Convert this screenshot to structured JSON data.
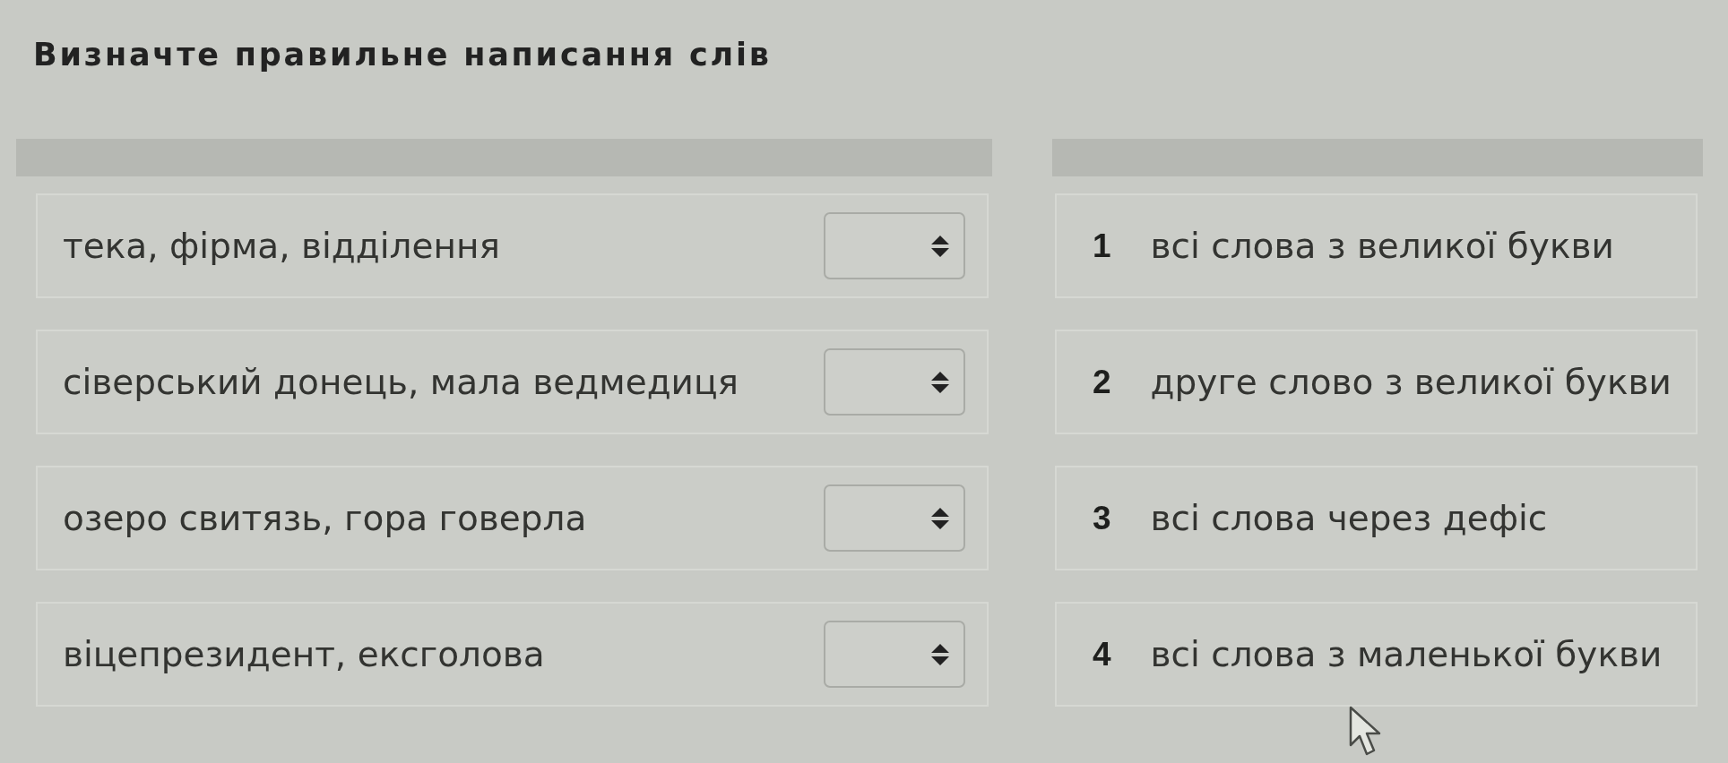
{
  "title": "Визначте правильне написання слів",
  "left_column": {
    "items": [
      {
        "text": "тека, фірма, відділення"
      },
      {
        "text": "сіверський донець, мала ведмедиця"
      },
      {
        "text": "озеро свитязь, гора говерла"
      },
      {
        "text": "віцепрезидент, ексголова"
      }
    ]
  },
  "right_column": {
    "items": [
      {
        "number": "1",
        "text": "всі слова з великої букви"
      },
      {
        "number": "2",
        "text": "друге слово з великої букви"
      },
      {
        "number": "3",
        "text": "всі слова через дефіс"
      },
      {
        "number": "4",
        "text": "всі слова з маленької букви"
      }
    ]
  },
  "mouse_pointer": {
    "kind": "arrow"
  }
}
